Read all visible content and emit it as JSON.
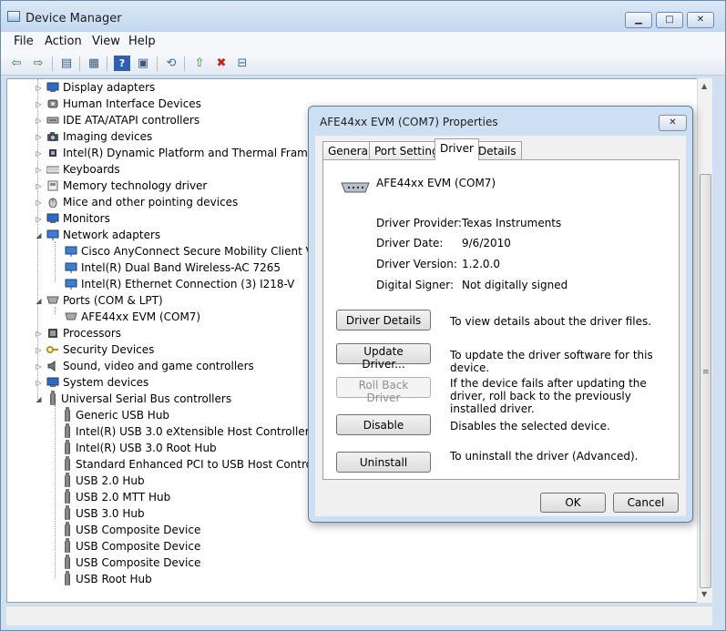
{
  "window": {
    "title": "Device Manager",
    "minimize_glyph": "▁",
    "maximize_glyph": "□",
    "close_glyph": "✕"
  },
  "menu": [
    "File",
    "Action",
    "View",
    "Help"
  ],
  "toolbar_icons": [
    "back-icon",
    "forward-icon",
    "show-hide-console-tree-icon",
    "properties-icon",
    "help-icon",
    "view-icon",
    "scan-hardware-icon",
    "update-driver-icon",
    "uninstall-icon",
    "disable-icon"
  ],
  "toolbar_glyphs": [
    "⇦",
    "⇨",
    "▤",
    "▦",
    "?",
    "▣",
    "⟲",
    "⇧",
    "✖",
    "⊟"
  ],
  "tree": {
    "categories_top": [
      {
        "label": "Display adapters",
        "icon": "display-adapter-icon"
      },
      {
        "label": "Human Interface Devices",
        "icon": "hid-icon"
      },
      {
        "label": "IDE ATA/ATAPI controllers",
        "icon": "ide-controller-icon"
      },
      {
        "label": "Imaging devices",
        "icon": "camera-icon"
      },
      {
        "label": "Intel(R) Dynamic Platform and Thermal Framework",
        "icon": "cpu-chip-icon"
      },
      {
        "label": "Keyboards",
        "icon": "keyboard-icon"
      },
      {
        "label": "Memory technology driver",
        "icon": "memory-card-icon"
      },
      {
        "label": "Mice and other pointing devices",
        "icon": "mouse-icon"
      },
      {
        "label": "Monitors",
        "icon": "monitor-icon"
      }
    ],
    "network": {
      "label": "Network adapters",
      "children": [
        "Cisco AnyConnect Secure Mobility Client Virtual Miniport Adapter for Windows x64",
        "Intel(R) Dual Band Wireless-AC 7265",
        "Intel(R) Ethernet Connection (3) I218-V"
      ]
    },
    "ports": {
      "label": "Ports (COM & LPT)",
      "children": [
        "AFE44xx EVM (COM7)"
      ]
    },
    "categories_mid": [
      {
        "label": "Processors",
        "icon": "processor-icon"
      },
      {
        "label": "Security Devices",
        "icon": "key-icon"
      },
      {
        "label": "Sound, video and game controllers",
        "icon": "speaker-icon"
      },
      {
        "label": "System devices",
        "icon": "system-device-icon"
      }
    ],
    "usb": {
      "label": "Universal Serial Bus controllers",
      "children": [
        "Generic USB Hub",
        "Intel(R) USB 3.0 eXtensible Host Controller",
        "Intel(R) USB 3.0 Root Hub",
        "Standard Enhanced PCI to USB Host Controller",
        "USB 2.0 Hub",
        "USB 2.0 MTT Hub",
        "USB 3.0 Hub",
        "USB Composite Device",
        "USB Composite Device",
        "USB Composite Device",
        "USB Root Hub"
      ]
    }
  },
  "dialog": {
    "title": "AFE44xx EVM (COM7) Properties",
    "close_glyph": "✕",
    "tabs": [
      "General",
      "Port Settings",
      "Driver",
      "Details"
    ],
    "active_tab": "Driver",
    "device_name": "AFE44xx EVM (COM7)",
    "fields": [
      {
        "label": "Driver Provider:",
        "value": "Texas Instruments"
      },
      {
        "label": "Driver Date:",
        "value": "9/6/2010"
      },
      {
        "label": "Driver Version:",
        "value": "1.2.0.0"
      },
      {
        "label": "Digital Signer:",
        "value": "Not digitally signed"
      }
    ],
    "actions": [
      {
        "label": "Driver Details",
        "desc": "To view details about the driver files.",
        "enabled": true
      },
      {
        "label": "Update Driver...",
        "desc": "To update the driver software for this device.",
        "enabled": true
      },
      {
        "label": "Roll Back Driver",
        "desc": "If the device fails after updating the driver, roll back to the previously installed driver.",
        "enabled": false
      },
      {
        "label": "Disable",
        "desc": "Disables the selected device.",
        "enabled": true
      },
      {
        "label": "Uninstall",
        "desc": "To uninstall the driver (Advanced).",
        "enabled": true
      }
    ],
    "ok_label": "OK",
    "cancel_label": "Cancel"
  },
  "scrollbar": {
    "up_glyph": "▲",
    "down_glyph": "▼",
    "grip_glyph": "≡"
  },
  "expander_glyphs": {
    "collapsed": "▷",
    "expanded": "◢"
  }
}
